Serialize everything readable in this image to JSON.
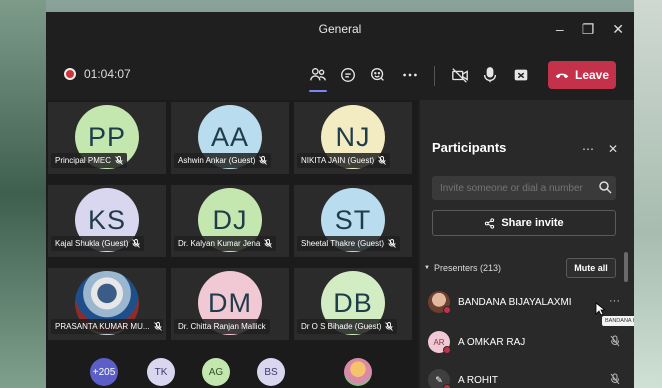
{
  "window": {
    "title": "General"
  },
  "meeting": {
    "timer": "01:04:07",
    "leave_label": "Leave"
  },
  "tiles": [
    {
      "initials": "PP",
      "name": "Principal PMEC",
      "color": "#c4e7b0"
    },
    {
      "initials": "AA",
      "name": "Ashwin Ankar (Guest)",
      "color": "#b9dcee"
    },
    {
      "initials": "NJ",
      "name": "NIKITA JAIN (Guest)",
      "color": "#f3ecc3"
    },
    {
      "initials": "KS",
      "name": "Kajal Shukla (Guest)",
      "color": "#d9d7ef"
    },
    {
      "initials": "DJ",
      "name": "Dr. Kalyan Kumar Jena",
      "color": "#c4e7b0"
    },
    {
      "initials": "ST",
      "name": "Sheetal Thakre (Guest)",
      "color": "#b9dcee"
    },
    {
      "initials": "",
      "name": "PRASANTA KUMAR MU...",
      "color": "#a9c4d8"
    },
    {
      "initials": "DM",
      "name": "Dr. Chitta Ranjan Mallick",
      "color": "#f1c9d4"
    },
    {
      "initials": "DB",
      "name": "Dr O S Bihade (Guest)",
      "color": "#d2ecc4"
    }
  ],
  "overflow": [
    {
      "label": "+205",
      "color": "#5b5fc7"
    },
    {
      "label": "TK",
      "color": "#d9d7ef"
    },
    {
      "label": "AG",
      "color": "#c4e7b0"
    },
    {
      "label": "BS",
      "color": "#d9d7ef"
    }
  ],
  "participants_panel": {
    "title": "Participants",
    "invite_placeholder": "Invite someone or dial a number",
    "share_label": "Share invite",
    "presenters_label": "Presenters (213)",
    "mute_all_label": "Mute all",
    "people": [
      {
        "initials": "",
        "name": "BANDANA BIJAYALAXMI",
        "color": "#b5806b",
        "right": "···"
      },
      {
        "initials": "AR",
        "name": "A OMKAR RAJ",
        "color": "#f1c9d4",
        "right": ""
      },
      {
        "initials": "",
        "name": "A ROHIT",
        "color": "#3f3f3f",
        "right": ""
      }
    ],
    "tooltip": "BANDANA BIJAYALAXMI"
  },
  "colors": {
    "accent": "#7f85f5",
    "leave": "#c4314b",
    "panel_bg": "#292929",
    "app_bg": "#1f1f1f"
  }
}
